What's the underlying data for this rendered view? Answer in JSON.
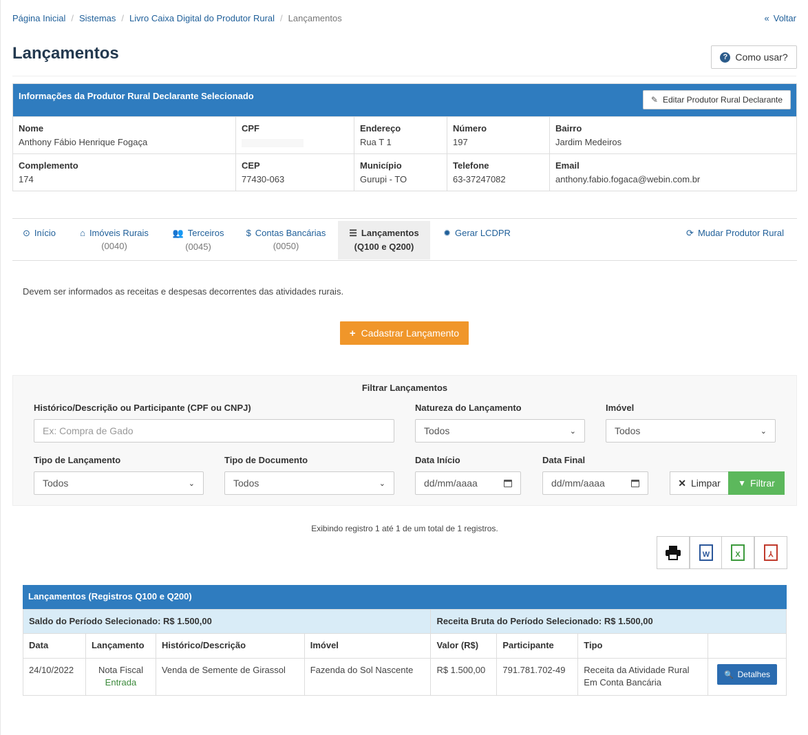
{
  "breadcrumb": {
    "items": [
      "Página Inicial",
      "Sistemas",
      "Livro Caixa Digital do Produtor Rural"
    ],
    "current": "Lançamentos"
  },
  "back_label": "Voltar",
  "page_title": "Lançamentos",
  "help_label": "Como usar?",
  "info_panel": {
    "title": "Informações da Produtor Rural Declarante Selecionado",
    "edit_label": "Editar Produtor Rural Declarante",
    "fields": [
      {
        "label": "Nome",
        "value": "Anthony Fábio Henrique Fogaça"
      },
      {
        "label": "CPF",
        "value": ""
      },
      {
        "label": "Endereço",
        "value": "Rua T 1"
      },
      {
        "label": "Número",
        "value": "197"
      },
      {
        "label": "Bairro",
        "value": "Jardim Medeiros"
      },
      {
        "label": "Complemento",
        "value": "174"
      },
      {
        "label": "CEP",
        "value": "77430-063"
      },
      {
        "label": "Município",
        "value": "Gurupi - TO"
      },
      {
        "label": "Telefone",
        "value": "63-37247082"
      },
      {
        "label": "Email",
        "value": "anthony.fabio.fogaca@webin.com.br"
      }
    ]
  },
  "tabs": [
    {
      "label": "Início",
      "sub": "",
      "icon": "circle-icon"
    },
    {
      "label": "Imóveis Rurais",
      "sub": "(0040)",
      "icon": "home-icon"
    },
    {
      "label": "Terceiros",
      "sub": "(0045)",
      "icon": "users-icon"
    },
    {
      "label": "Contas Bancárias",
      "sub": "(0050)",
      "icon": "dollar-icon"
    },
    {
      "label": "Lançamentos",
      "sub": "(Q100 e Q200)",
      "icon": "list-icon"
    },
    {
      "label": "Gerar LCDPR",
      "sub": "",
      "icon": "cog-icon"
    },
    {
      "label": "Mudar Produtor Rural",
      "sub": "",
      "icon": "refresh-icon"
    }
  ],
  "description": "Devem ser informados as receitas e despesas decorrentes das atividades rurais.",
  "add_button": "Cadastrar Lançamento",
  "filter": {
    "title": "Filtrar Lançamentos",
    "historico_label": "Histórico/Descrição ou Participante (CPF ou CNPJ)",
    "historico_placeholder": "Ex: Compra de Gado",
    "natureza_label": "Natureza do Lançamento",
    "natureza_value": "Todos",
    "imovel_label": "Imóvel",
    "imovel_value": "Todos",
    "tipo_lanc_label": "Tipo de Lançamento",
    "tipo_lanc_value": "Todos",
    "tipo_doc_label": "Tipo de Documento",
    "tipo_doc_value": "Todos",
    "data_inicio_label": "Data Início",
    "data_final_label": "Data Final",
    "date_placeholder": "dd/mm/aaaa",
    "clear_label": "Limpar",
    "filter_label": "Filtrar"
  },
  "showing_text": "Exibindo registro 1 até 1 de um total de 1 registros.",
  "table": {
    "title": "Lançamentos (Registros Q100 e Q200)",
    "saldo": "Saldo do Período Selecionado: R$ 1.500,00",
    "receita": "Receita Bruta do Período Selecionado: R$ 1.500,00",
    "columns": [
      "Data",
      "Lançamento",
      "Histórico/Descrição",
      "Imóvel",
      "Valor (R$)",
      "Participante",
      "Tipo",
      ""
    ],
    "rows": [
      {
        "data": "24/10/2022",
        "lancamento": "Nota Fiscal",
        "lancamento_sub": "Entrada",
        "historico": "Venda de Semente de Girassol",
        "imovel": "Fazenda do Sol Nascente",
        "valor": "R$ 1.500,00",
        "participante": "791.781.702-49",
        "tipo_line1": "Receita da Atividade Rural",
        "tipo_line2": "Em Conta Bancária",
        "action": "Detalhes"
      }
    ]
  },
  "colors": {
    "primary": "#2f7cbf",
    "orange": "#f0962a",
    "green": "#5cb85c",
    "saldo_bg": "#d9ecf7"
  }
}
